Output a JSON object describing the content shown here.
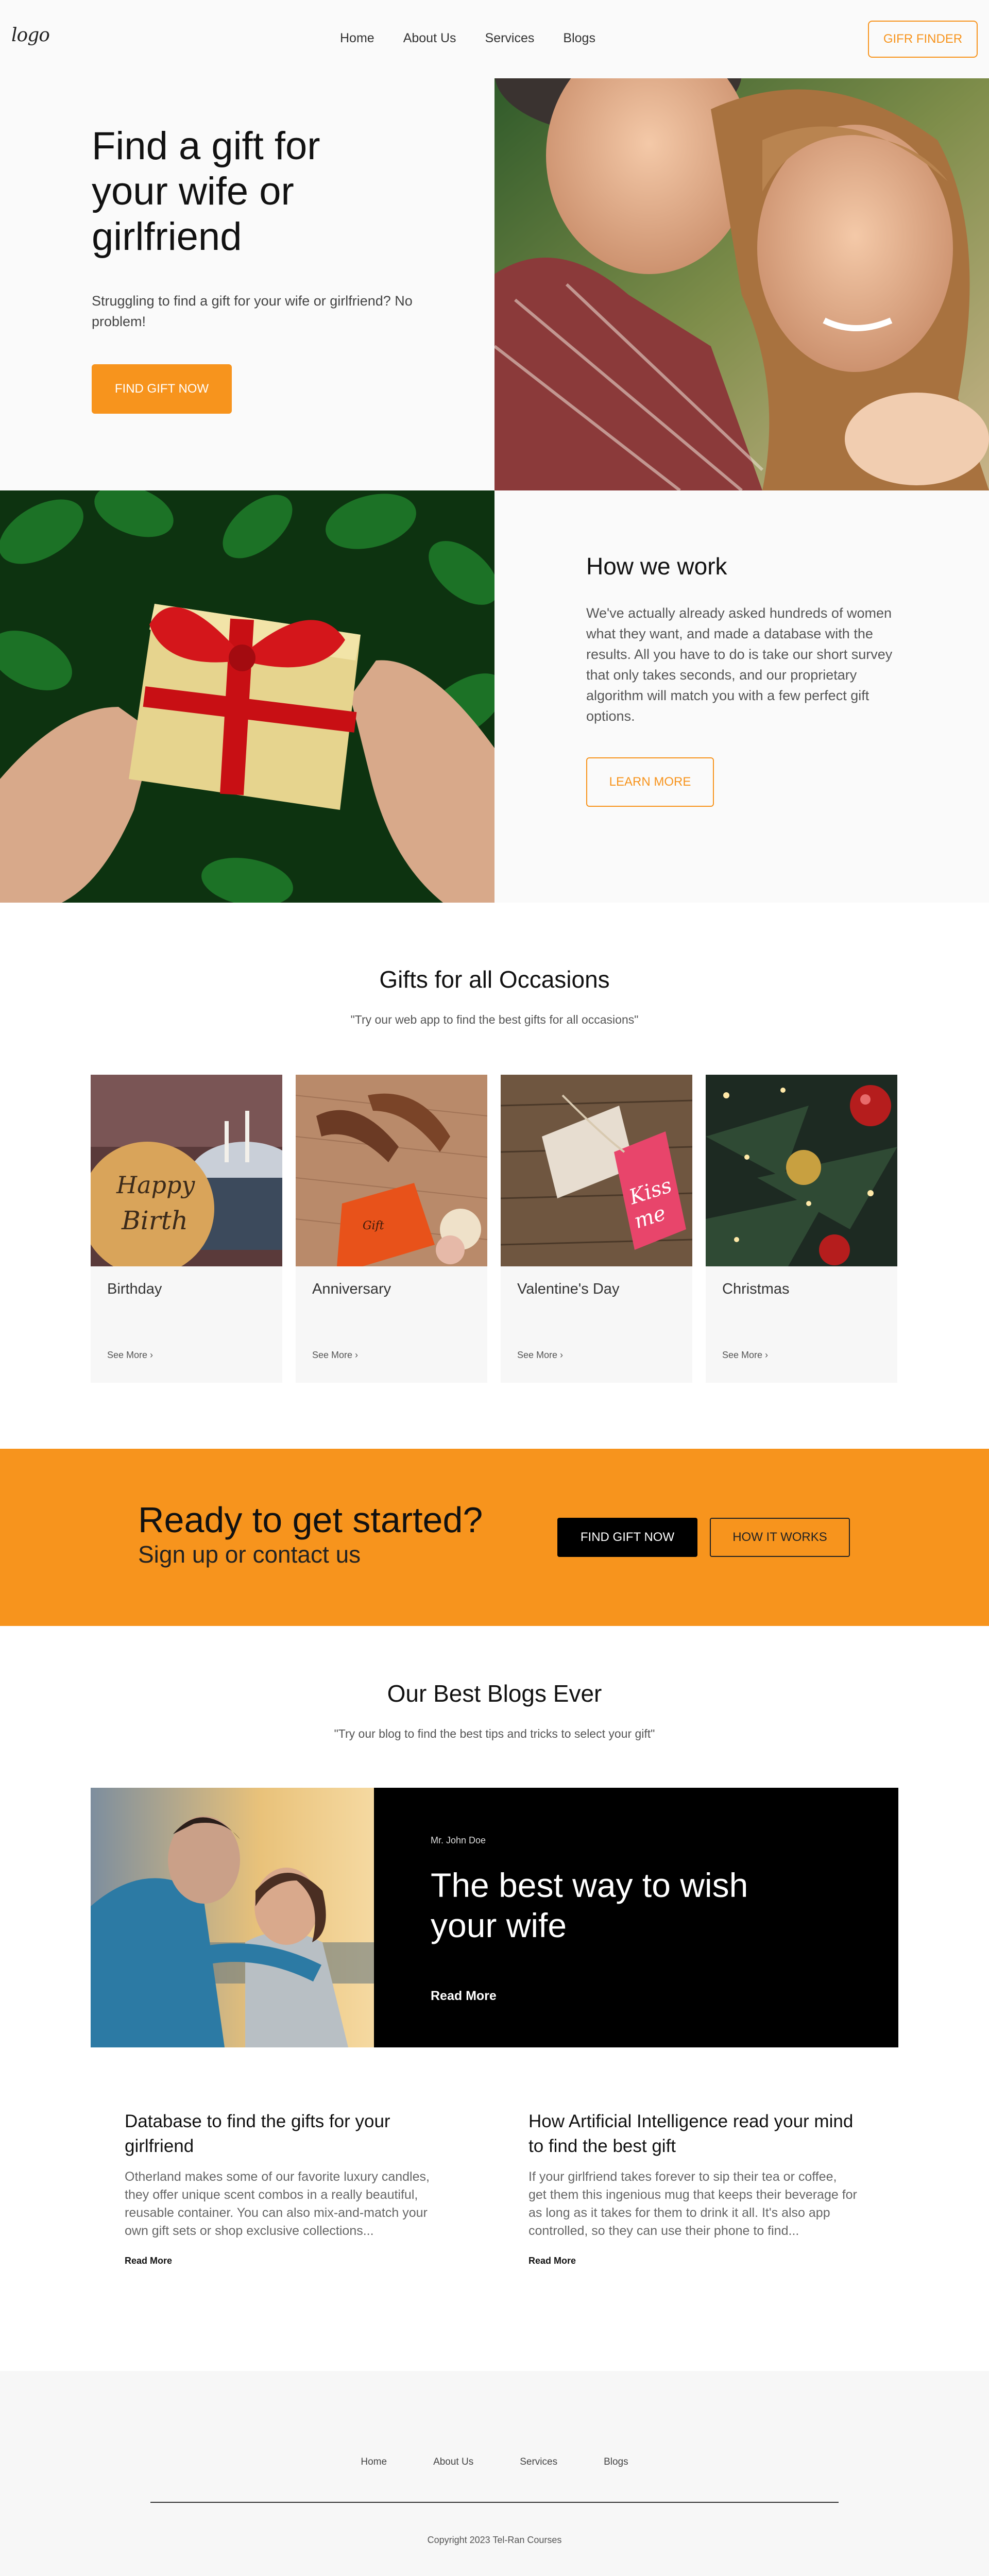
{
  "header": {
    "logo": "logo",
    "nav": [
      "Home",
      "About Us",
      "Services",
      "Blogs"
    ],
    "finder_button": "GIFR FINDER"
  },
  "hero": {
    "title": "Find a gift for your wife or girlfriend",
    "subtitle": "Struggling to find a gift for your wife or girlfriend? No problem!",
    "button": "FIND GIFT NOW"
  },
  "how": {
    "title": "How we work",
    "text": "We've actually already asked hundreds of women what they want, and made a database with the results. All you have to do is take our short survey that only takes seconds, and our proprietary algorithm will match you with a few perfect gift options.",
    "button": "LEARN MORE"
  },
  "occasions": {
    "title": "Gifts for all Occasions",
    "subtitle": "\"Try our web app to find the best gifts for all occasions\"",
    "cards": [
      {
        "title": "Birthday",
        "link": "See More ›"
      },
      {
        "title": "Anniversary",
        "link": "See More ›"
      },
      {
        "title": "Valentine's Day",
        "link": "See More ›"
      },
      {
        "title": "Christmas",
        "link": "See More ›"
      }
    ]
  },
  "cta": {
    "title": "Ready to get started?",
    "subtitle": "Sign up or contact us",
    "primary": "FIND GIFT NOW",
    "secondary": "HOW IT WORKS"
  },
  "blogs": {
    "title": "Our Best Blogs Ever",
    "subtitle": "\"Try our blog to find the best tips and tricks to select your gift\"",
    "feature": {
      "author": "Mr. John Doe",
      "title": "The best way to wish your wife",
      "link": "Read More"
    },
    "posts": [
      {
        "title": "Database to find the gifts for your girlfriend",
        "text": "Otherland makes some of our favorite luxury candles, they offer unique scent combos in a really beautiful, reusable container. You can also mix-and-match your own gift sets or shop exclusive collections...",
        "link": "Read More"
      },
      {
        "title": "How Artificial Intelligence read your mind to find the best gift",
        "text": "If your girlfriend takes forever to sip their tea or coffee, get them this ingenious mug that keeps their beverage for as long as it takes for them to drink it all. It's also app controlled, so they can use their phone to find...",
        "link": "Read More"
      }
    ]
  },
  "footer": {
    "nav": [
      "Home",
      "About Us",
      "Services",
      "Blogs"
    ],
    "copyright": "Copyright 2023 Tel-Ran Courses"
  },
  "colors": {
    "accent": "#f7941d",
    "background": "#fafafa",
    "dark": "#000000"
  }
}
